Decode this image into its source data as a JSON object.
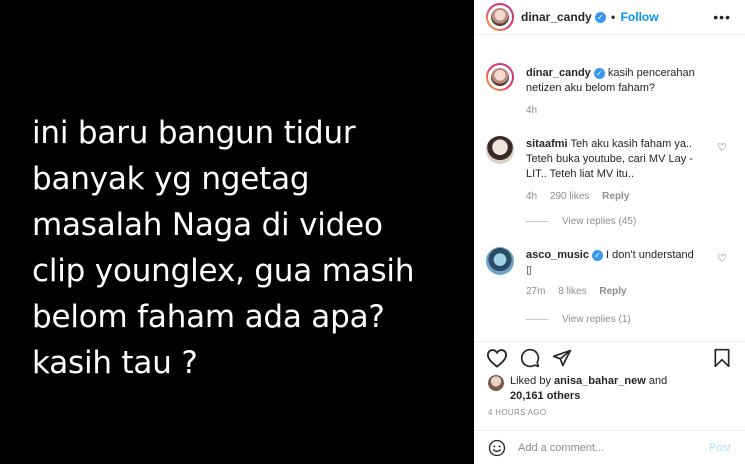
{
  "media": {
    "caption_text": "ini baru bangun tidur\nbanyak yg ngetag\nmasalah Naga di video\nclip younglex, gua masih\nbelom faham ada apa?\nkasih tau ?"
  },
  "header": {
    "username": "dinar_candy",
    "separator": "•",
    "follow_label": "Follow",
    "more_label": "•••"
  },
  "caption": {
    "username": "dinar_candy",
    "text": "kasih pencerahan netizen aku belom faham?",
    "time": "4h"
  },
  "comments": [
    {
      "username": "sitaafmi",
      "text": "Teh aku kasih faham ya.. Teteh buka youtube, cari MV Lay - LIT.. Teteh liat MV itu..",
      "time": "4h",
      "likes": "290 likes",
      "reply_label": "Reply",
      "view_replies": "View replies (45)"
    },
    {
      "username": "asco_music",
      "text": "I don't understand",
      "glyph": "▯",
      "time": "27m",
      "likes": "8 likes",
      "reply_label": "Reply",
      "view_replies": "View replies (1)"
    }
  ],
  "likes": {
    "prefix": "Liked by",
    "user": "anisa_bahar_new",
    "and": "and",
    "others": "20,161 others"
  },
  "timestamp": "4 HOURS AGO",
  "comment_box": {
    "placeholder": "Add a comment...",
    "post_label": "Post"
  },
  "colors": {
    "accent": "#0095f6",
    "verified": "#3897f0",
    "muted": "#8e8e8e",
    "post_disabled": "#b2dffc"
  },
  "icons": [
    "heart-icon",
    "comment-icon",
    "share-icon",
    "bookmark-icon",
    "emoji-icon",
    "verified-icon",
    "more-icon"
  ]
}
